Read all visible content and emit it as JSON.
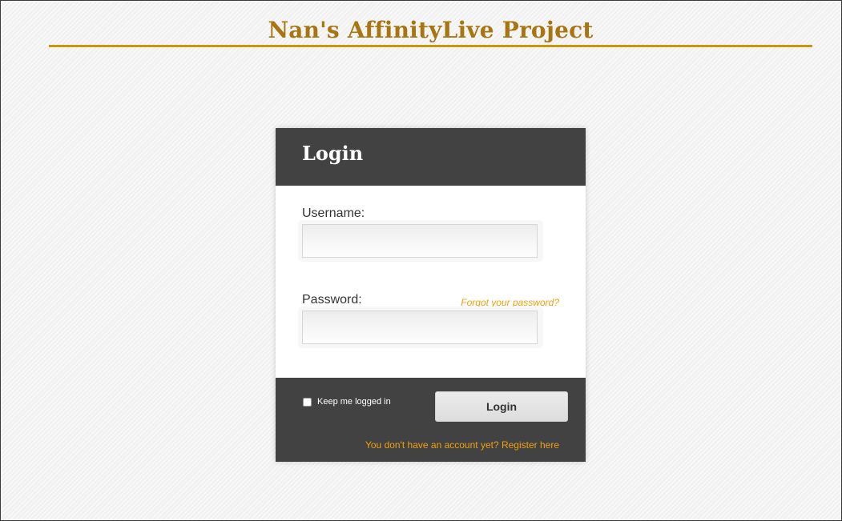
{
  "header": {
    "title": "Nan's AffinityLive Project"
  },
  "login": {
    "heading": "Login",
    "username_label": "Username:",
    "username_value": "",
    "password_label": "Password:",
    "password_value": "",
    "forgot_link": "Forgot your password?",
    "remember_label": "Keep me logged in",
    "submit_label": "Login",
    "register_link": "You don't have an account yet? Register here"
  },
  "colors": {
    "brand_gold": "#a87510",
    "rule_gold": "#c9970a",
    "panel_dark": "#424242",
    "link_orange": "#f0a010"
  }
}
